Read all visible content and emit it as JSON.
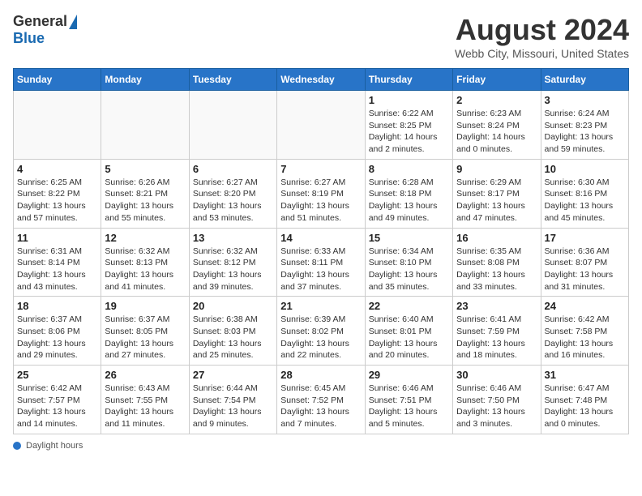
{
  "header": {
    "logo_general": "General",
    "logo_blue": "Blue",
    "title": "August 2024",
    "subtitle": "Webb City, Missouri, United States"
  },
  "calendar": {
    "days_of_week": [
      "Sunday",
      "Monday",
      "Tuesday",
      "Wednesday",
      "Thursday",
      "Friday",
      "Saturday"
    ],
    "weeks": [
      [
        {
          "day": "",
          "info": ""
        },
        {
          "day": "",
          "info": ""
        },
        {
          "day": "",
          "info": ""
        },
        {
          "day": "",
          "info": ""
        },
        {
          "day": "1",
          "info": "Sunrise: 6:22 AM\nSunset: 8:25 PM\nDaylight: 14 hours\nand 2 minutes."
        },
        {
          "day": "2",
          "info": "Sunrise: 6:23 AM\nSunset: 8:24 PM\nDaylight: 14 hours\nand 0 minutes."
        },
        {
          "day": "3",
          "info": "Sunrise: 6:24 AM\nSunset: 8:23 PM\nDaylight: 13 hours\nand 59 minutes."
        }
      ],
      [
        {
          "day": "4",
          "info": "Sunrise: 6:25 AM\nSunset: 8:22 PM\nDaylight: 13 hours\nand 57 minutes."
        },
        {
          "day": "5",
          "info": "Sunrise: 6:26 AM\nSunset: 8:21 PM\nDaylight: 13 hours\nand 55 minutes."
        },
        {
          "day": "6",
          "info": "Sunrise: 6:27 AM\nSunset: 8:20 PM\nDaylight: 13 hours\nand 53 minutes."
        },
        {
          "day": "7",
          "info": "Sunrise: 6:27 AM\nSunset: 8:19 PM\nDaylight: 13 hours\nand 51 minutes."
        },
        {
          "day": "8",
          "info": "Sunrise: 6:28 AM\nSunset: 8:18 PM\nDaylight: 13 hours\nand 49 minutes."
        },
        {
          "day": "9",
          "info": "Sunrise: 6:29 AM\nSunset: 8:17 PM\nDaylight: 13 hours\nand 47 minutes."
        },
        {
          "day": "10",
          "info": "Sunrise: 6:30 AM\nSunset: 8:16 PM\nDaylight: 13 hours\nand 45 minutes."
        }
      ],
      [
        {
          "day": "11",
          "info": "Sunrise: 6:31 AM\nSunset: 8:14 PM\nDaylight: 13 hours\nand 43 minutes."
        },
        {
          "day": "12",
          "info": "Sunrise: 6:32 AM\nSunset: 8:13 PM\nDaylight: 13 hours\nand 41 minutes."
        },
        {
          "day": "13",
          "info": "Sunrise: 6:32 AM\nSunset: 8:12 PM\nDaylight: 13 hours\nand 39 minutes."
        },
        {
          "day": "14",
          "info": "Sunrise: 6:33 AM\nSunset: 8:11 PM\nDaylight: 13 hours\nand 37 minutes."
        },
        {
          "day": "15",
          "info": "Sunrise: 6:34 AM\nSunset: 8:10 PM\nDaylight: 13 hours\nand 35 minutes."
        },
        {
          "day": "16",
          "info": "Sunrise: 6:35 AM\nSunset: 8:08 PM\nDaylight: 13 hours\nand 33 minutes."
        },
        {
          "day": "17",
          "info": "Sunrise: 6:36 AM\nSunset: 8:07 PM\nDaylight: 13 hours\nand 31 minutes."
        }
      ],
      [
        {
          "day": "18",
          "info": "Sunrise: 6:37 AM\nSunset: 8:06 PM\nDaylight: 13 hours\nand 29 minutes."
        },
        {
          "day": "19",
          "info": "Sunrise: 6:37 AM\nSunset: 8:05 PM\nDaylight: 13 hours\nand 27 minutes."
        },
        {
          "day": "20",
          "info": "Sunrise: 6:38 AM\nSunset: 8:03 PM\nDaylight: 13 hours\nand 25 minutes."
        },
        {
          "day": "21",
          "info": "Sunrise: 6:39 AM\nSunset: 8:02 PM\nDaylight: 13 hours\nand 22 minutes."
        },
        {
          "day": "22",
          "info": "Sunrise: 6:40 AM\nSunset: 8:01 PM\nDaylight: 13 hours\nand 20 minutes."
        },
        {
          "day": "23",
          "info": "Sunrise: 6:41 AM\nSunset: 7:59 PM\nDaylight: 13 hours\nand 18 minutes."
        },
        {
          "day": "24",
          "info": "Sunrise: 6:42 AM\nSunset: 7:58 PM\nDaylight: 13 hours\nand 16 minutes."
        }
      ],
      [
        {
          "day": "25",
          "info": "Sunrise: 6:42 AM\nSunset: 7:57 PM\nDaylight: 13 hours\nand 14 minutes."
        },
        {
          "day": "26",
          "info": "Sunrise: 6:43 AM\nSunset: 7:55 PM\nDaylight: 13 hours\nand 11 minutes."
        },
        {
          "day": "27",
          "info": "Sunrise: 6:44 AM\nSunset: 7:54 PM\nDaylight: 13 hours\nand 9 minutes."
        },
        {
          "day": "28",
          "info": "Sunrise: 6:45 AM\nSunset: 7:52 PM\nDaylight: 13 hours\nand 7 minutes."
        },
        {
          "day": "29",
          "info": "Sunrise: 6:46 AM\nSunset: 7:51 PM\nDaylight: 13 hours\nand 5 minutes."
        },
        {
          "day": "30",
          "info": "Sunrise: 6:46 AM\nSunset: 7:50 PM\nDaylight: 13 hours\nand 3 minutes."
        },
        {
          "day": "31",
          "info": "Sunrise: 6:47 AM\nSunset: 7:48 PM\nDaylight: 13 hours\nand 0 minutes."
        }
      ]
    ]
  },
  "footer": {
    "daylight_label": "Daylight hours"
  }
}
